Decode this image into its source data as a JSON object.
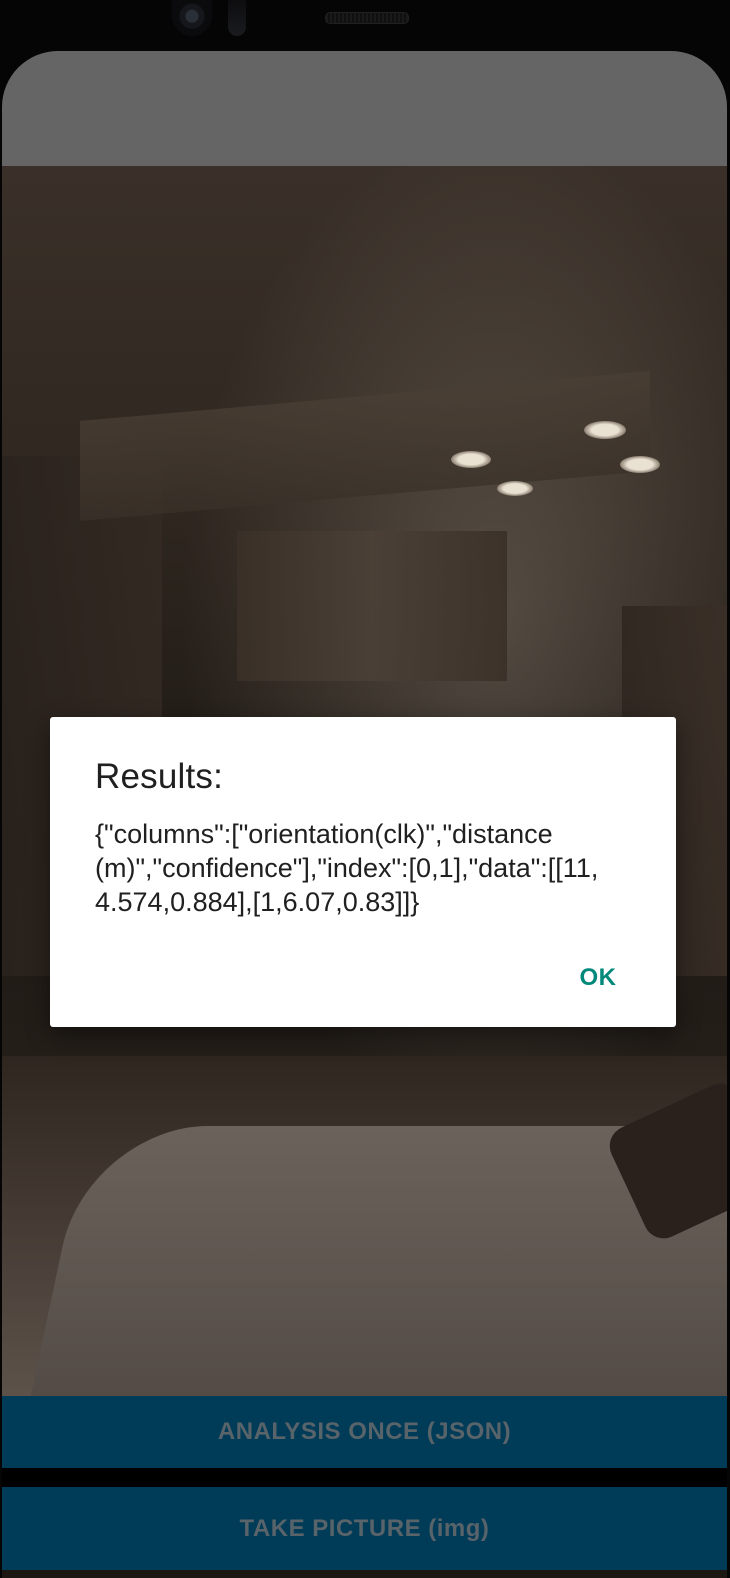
{
  "dialog": {
    "title": "Results:",
    "message": "{\"columns\":[\"orientation(clk)\",\"distance(m)\",\"confidence\"],\"index\":[0,1],\"data\":[[11,4.574,0.884],[1,6.07,0.83]]}",
    "ok_label": "OK"
  },
  "buttons": {
    "analysis_label": "ANALYSIS ONCE (JSON)",
    "take_picture_label": "TAKE PICTURE (img)"
  },
  "colors": {
    "app_bar": "#656565",
    "button_background": "#003c58",
    "button_text": "#58636a",
    "dialog_action": "#00897b"
  }
}
